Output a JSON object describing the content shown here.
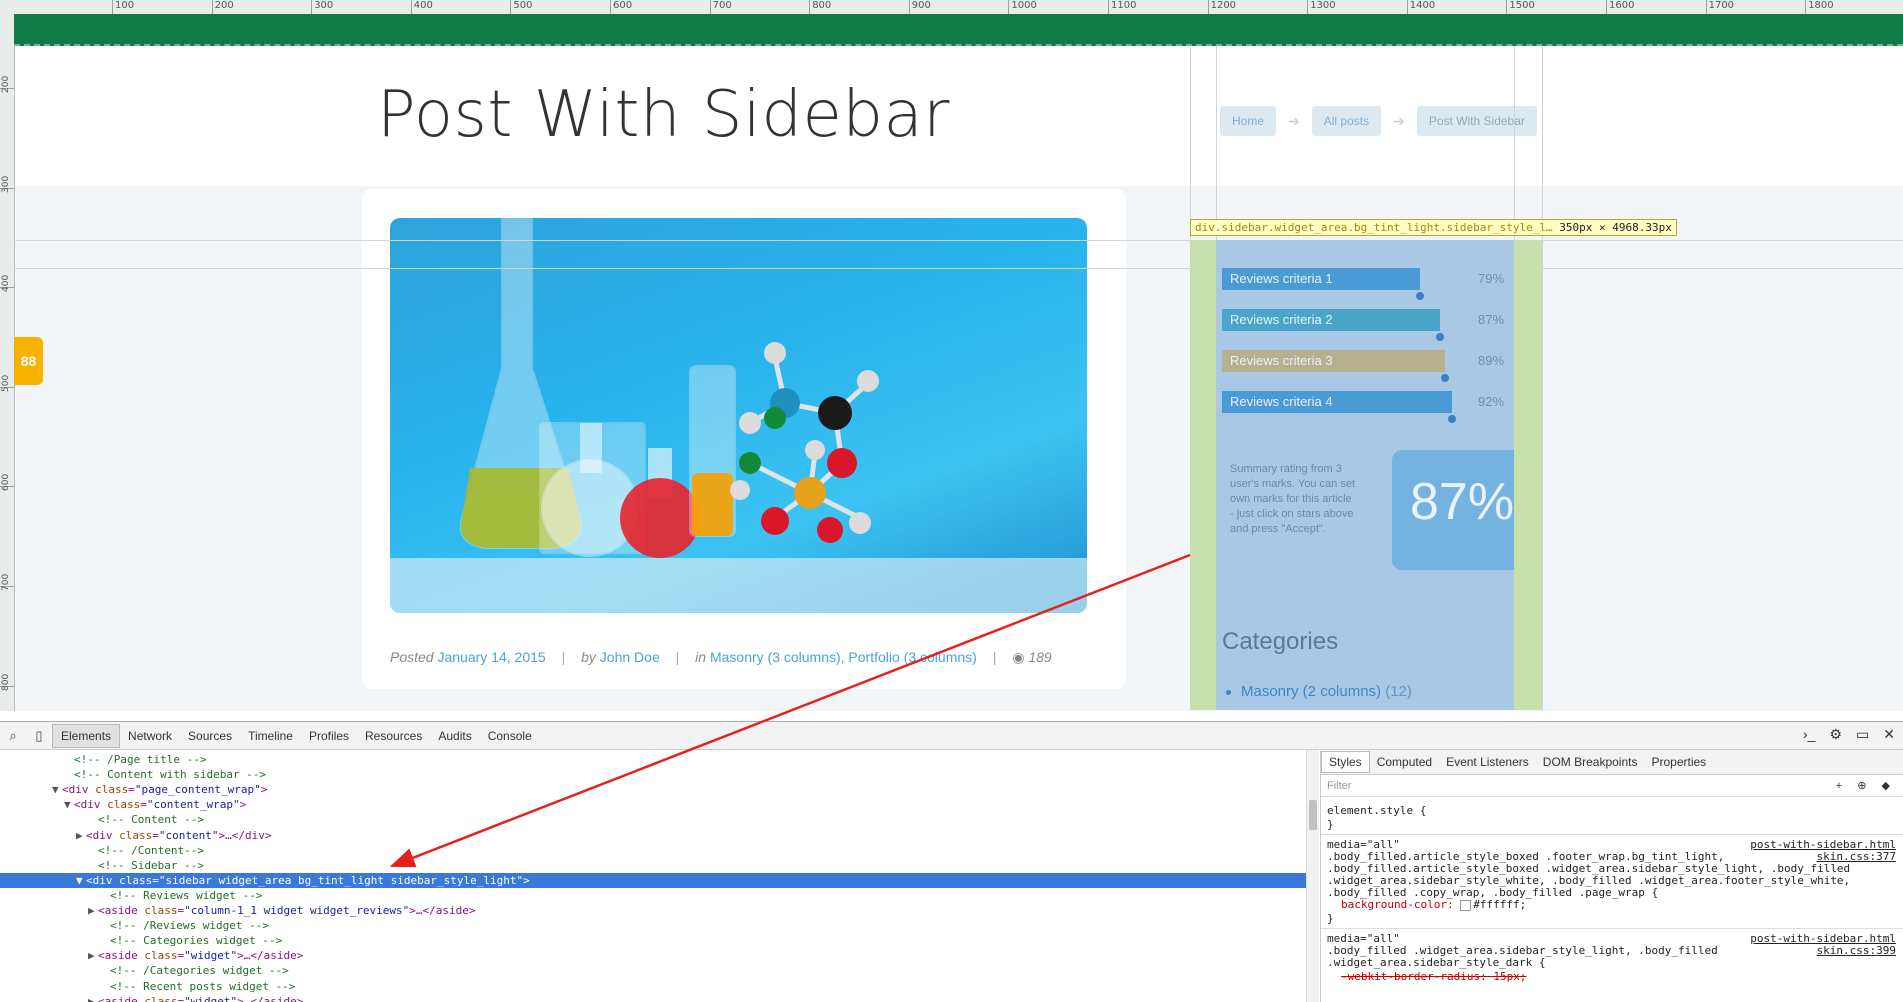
{
  "ruler": {
    "top_labels": [
      "100",
      "200",
      "300",
      "400",
      "500",
      "600",
      "700",
      "800",
      "900",
      "1000",
      "1100",
      "1200",
      "1300",
      "1400",
      "1500",
      "1600",
      "1700",
      "1800"
    ],
    "left_labels": [
      "200",
      "300",
      "400",
      "500",
      "600",
      "700",
      "800"
    ]
  },
  "page": {
    "title": "Post With Sidebar",
    "breadcrumbs": [
      "Home",
      "All posts",
      "Post With Sidebar"
    ],
    "breadcrumb_sep": "➔",
    "gadget_label": "88"
  },
  "post_meta": {
    "posted_label": "Posted",
    "date": "January 14, 2015",
    "by_label": "by",
    "author": "John Doe",
    "in_label": "in",
    "categories": "Masonry (3 columns), Portfolio (3 columns)",
    "views": "189",
    "separator": "|"
  },
  "inspector_tooltip": {
    "selector": "div.sidebar.widget_area.bg_tint_light.sidebar_style_l…",
    "size": "350px × 4968.33px"
  },
  "reviews": {
    "criteria": [
      {
        "label": "Reviews criteria 1",
        "percent": "79%",
        "value": 79,
        "color": "#4a9ad6"
      },
      {
        "label": "Reviews criteria 2",
        "percent": "87%",
        "value": 87,
        "color": "#4aa6c9"
      },
      {
        "label": "Reviews criteria 3",
        "percent": "89%",
        "value": 89,
        "color": "#b5b08e"
      },
      {
        "label": "Reviews criteria 4",
        "percent": "92%",
        "value": 92,
        "color": "#4a9ad6"
      }
    ],
    "summary_text": "Summary rating from 3 user's marks. You can set own marks for this article - just click on stars above and press \"Accept\".",
    "summary_percent": "87%"
  },
  "categories": {
    "title": "Categories",
    "first_item": "Masonry (2 columns)",
    "first_count": "(12)"
  },
  "devtools": {
    "tabs": [
      "Elements",
      "Network",
      "Sources",
      "Timeline",
      "Profiles",
      "Resources",
      "Audits",
      "Console"
    ],
    "active_tab": "Elements",
    "elements_lines": [
      {
        "indent": 5,
        "tri": "",
        "text": "<!-- /Page title -->",
        "type": "com"
      },
      {
        "indent": 5,
        "tri": "",
        "text": "<!-- Content with sidebar -->",
        "type": "com"
      },
      {
        "indent": 4,
        "tri": "▼",
        "tag": "div",
        "cls": "page_content_wrap",
        "tail": ">",
        "type": "tag"
      },
      {
        "indent": 5,
        "tri": "▼",
        "tag": "div",
        "cls": "content_wrap",
        "tail": ">",
        "type": "tag"
      },
      {
        "indent": 7,
        "tri": "",
        "text": "<!-- Content -->",
        "type": "com"
      },
      {
        "indent": 6,
        "tri": "▶",
        "tag": "div",
        "cls": "content",
        "tail": ">…</div>",
        "type": "tag"
      },
      {
        "indent": 7,
        "tri": "",
        "text": "<!-- /Content-->",
        "type": "com"
      },
      {
        "indent": 7,
        "tri": "",
        "text": "<!-- Sidebar -->",
        "type": "com"
      },
      {
        "indent": 6,
        "tri": "▼",
        "tag": "div",
        "cls": "sidebar widget_area bg_tint_light sidebar_style_light",
        "tail": ">",
        "type": "tag",
        "selected": true
      },
      {
        "indent": 8,
        "tri": "",
        "text": "<!-- Reviews widget -->",
        "type": "com"
      },
      {
        "indent": 7,
        "tri": "▶",
        "tag": "aside",
        "cls": "column-1_1 widget widget_reviews",
        "tail": ">…</aside>",
        "type": "tag"
      },
      {
        "indent": 8,
        "tri": "",
        "text": "<!-- /Reviews widget -->",
        "type": "com"
      },
      {
        "indent": 8,
        "tri": "",
        "text": "<!-- Categories widget -->",
        "type": "com"
      },
      {
        "indent": 7,
        "tri": "▶",
        "tag": "aside",
        "cls": "widget",
        "tail": ">…</aside>",
        "type": "tag"
      },
      {
        "indent": 8,
        "tri": "",
        "text": "<!-- /Categories widget -->",
        "type": "com"
      },
      {
        "indent": 8,
        "tri": "",
        "text": "<!-- Recent posts widget -->",
        "type": "com"
      },
      {
        "indent": 7,
        "tri": "▶",
        "tag": "aside",
        "cls": "widget",
        "tail": ">…</aside>",
        "type": "tag"
      }
    ],
    "styles_tabs": [
      "Styles",
      "Computed",
      "Event Listeners",
      "DOM Breakpoints",
      "Properties"
    ],
    "filter_placeholder": "Filter",
    "filter_actions": "+ ⊕ ◆",
    "element_style": "element.style {",
    "close_brace": "}",
    "rule1": {
      "media": "media=\"all\"",
      "source": "post-with-sidebar.html",
      "source2": "skin.css:377",
      "sel1": ".body_filled.article_style_boxed .footer_wrap.bg_tint_light,",
      "sel2": ".body_filled.article_style_boxed .widget_area.sidebar_style_light, .body_filled",
      "sel3": ".widget_area.sidebar_style_white, .body_filled .widget_area.footer_style_white,",
      "sel4": ".body_filled .copy_wrap, .body_filled .page_wrap {",
      "prop": "background-color:",
      "value": "#ffffff;"
    },
    "rule2": {
      "media": "media=\"all\"",
      "source": "post-with-sidebar.html",
      "source2": "skin.css:399",
      "sel1": ".body_filled .widget_area.sidebar_style_light, .body_filled",
      "sel2": ".widget_area.sidebar_style_dark {",
      "prop": "-webkit-border-radius: 15px;"
    }
  },
  "colors": {
    "header_green": "#0e7a45",
    "sidebar_highlight": "#c8dfae",
    "sidebar_inner": "#a9c8e6",
    "selection": "#3879d9",
    "arrow": "#e8201a"
  }
}
